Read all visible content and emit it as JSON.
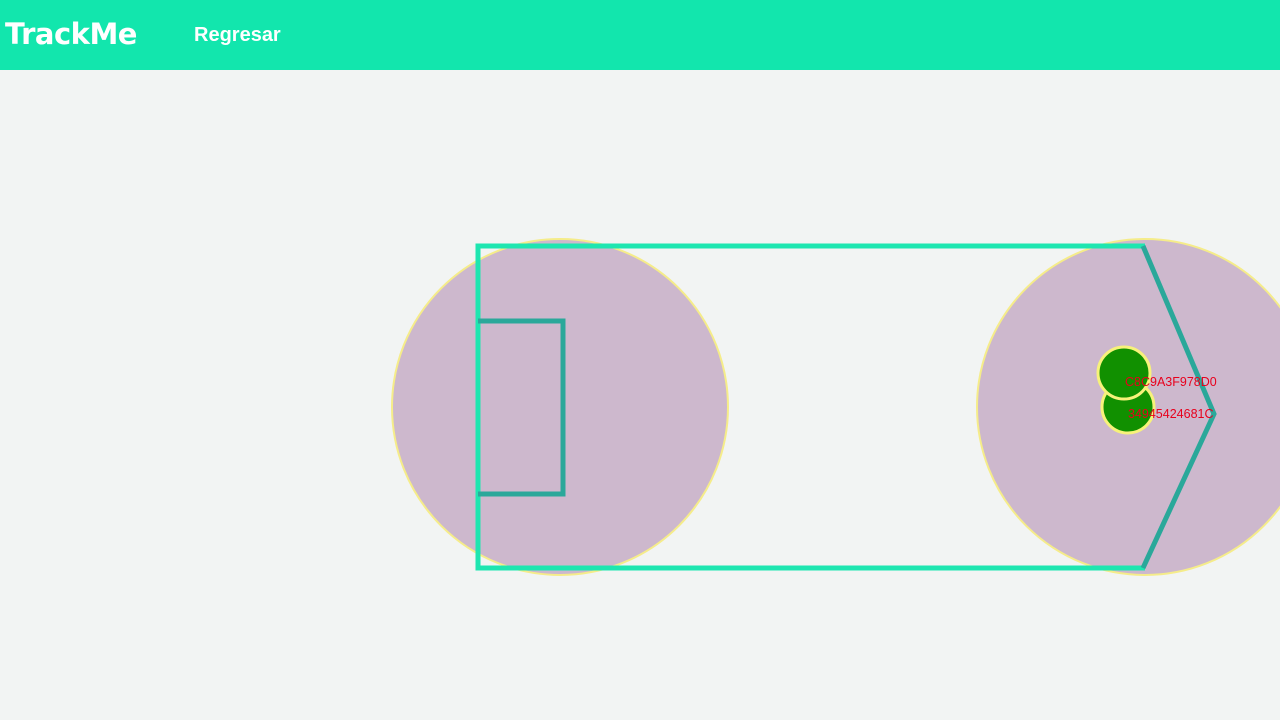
{
  "navbar": {
    "brand": "TrackMe",
    "back_link": "Regresar",
    "color": "#12e6ad"
  },
  "map": {
    "zone_fill": "#cdb8cd",
    "zone_stroke": "#f5ec8a",
    "boundary_color": "#1ee6b0",
    "pitch_line_color": "#2aa89a",
    "tag_fill": "#119000",
    "tag_stroke": "#f7f27a",
    "label_color": "#e8001c",
    "tags": [
      {
        "id": "C8C9A3F978D0"
      },
      {
        "id": "34945424681C"
      }
    ]
  }
}
